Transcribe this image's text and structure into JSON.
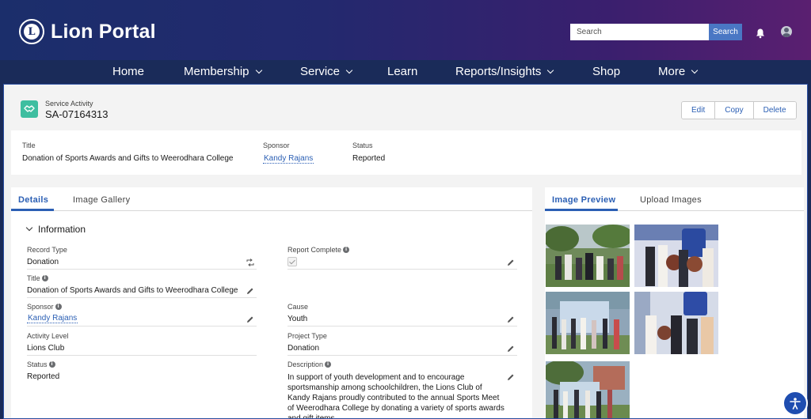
{
  "header": {
    "title": "Lion Portal",
    "search_placeholder": "Search",
    "search_button": "Search"
  },
  "nav": {
    "items": [
      {
        "label": "Home",
        "dropdown": false
      },
      {
        "label": "Membership",
        "dropdown": true
      },
      {
        "label": "Service",
        "dropdown": true
      },
      {
        "label": "Learn",
        "dropdown": false
      },
      {
        "label": "Reports/Insights",
        "dropdown": true
      },
      {
        "label": "Shop",
        "dropdown": false
      },
      {
        "label": "More",
        "dropdown": true
      }
    ]
  },
  "record": {
    "object_type": "Service Activity",
    "number": "SA-07164313",
    "actions": {
      "edit": "Edit",
      "copy": "Copy",
      "delete": "Delete"
    },
    "icon": "handshake-icon"
  },
  "highlights": {
    "title_label": "Title",
    "title_value": "Donation of Sports Awards and Gifts to Weerodhara College",
    "sponsor_label": "Sponsor",
    "sponsor_value": "Kandy Rajans",
    "status_label": "Status",
    "status_value": "Reported"
  },
  "detail_tabs": {
    "details": "Details",
    "gallery": "Image Gallery"
  },
  "section": {
    "title": "Information"
  },
  "fields": {
    "record_type": {
      "label": "Record Type",
      "value": "Donation"
    },
    "report_complete": {
      "label": "Report Complete",
      "checked": true
    },
    "title": {
      "label": "Title",
      "value": "Donation of Sports Awards and Gifts to Weerodhara College"
    },
    "sponsor": {
      "label": "Sponsor",
      "value": "Kandy Rajans"
    },
    "cause": {
      "label": "Cause",
      "value": "Youth"
    },
    "activity_level": {
      "label": "Activity Level",
      "value": "Lions Club"
    },
    "project_type": {
      "label": "Project Type",
      "value": "Donation"
    },
    "status": {
      "label": "Status",
      "value": "Reported"
    },
    "description": {
      "label": "Description",
      "value": "In support of youth development and to encourage sportsmanship among schoolchildren, the Lions Club of Kandy Rajans proudly contributed to the annual Sports Meet of Weerodhara College by donating a variety of sports awards and gift items..."
    }
  },
  "image_tabs": {
    "preview": "Image Preview",
    "upload": "Upload Images"
  },
  "colors": {
    "header_start": "#1b2e6b",
    "header_end": "#5a1f70",
    "nav_bg": "#1a2b59",
    "accent": "#2b5fb4",
    "record_icon": "#3ebea0"
  }
}
